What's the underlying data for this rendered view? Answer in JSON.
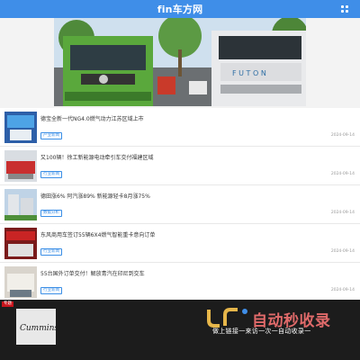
{
  "header": {
    "logo": "fin车方网",
    "menu_icon": "grid-menu-icon",
    "bar_color": "#3f8ee8"
  },
  "news": [
    {
      "title": "德宝全新一代NG4.0燃气动力江苏区域上市",
      "tag": "产业新闻",
      "date": "2024-09-14"
    },
    {
      "title": "又100辆！徐工新能源电动牵引车交付福建区域",
      "tag": "行业新闻",
      "date": "2024-09-14"
    },
    {
      "title": "德田涨6% 阿汽涨89% 新能源轻卡8月涨75%",
      "tag": "数据分析",
      "date": "2024-09-14"
    },
    {
      "title": "东风商用车签订55辆6X4燃气智能重卡意向订单",
      "tag": "行业新闻",
      "date": "2024-09-14"
    },
    {
      "title": "55台国外订单交付！解放青汽在印尼到交车",
      "tag": "行业新闻",
      "date": "2024-09-14"
    }
  ],
  "ad": {
    "badge": "专题",
    "brand": "Cummins"
  },
  "watermark": {
    "title": "自动秒收录",
    "subtitle": "做上链接一来访一次一自动收录一"
  },
  "colors": {
    "accent": "#3a8ee6",
    "tag_border": "#3a8ee6"
  }
}
